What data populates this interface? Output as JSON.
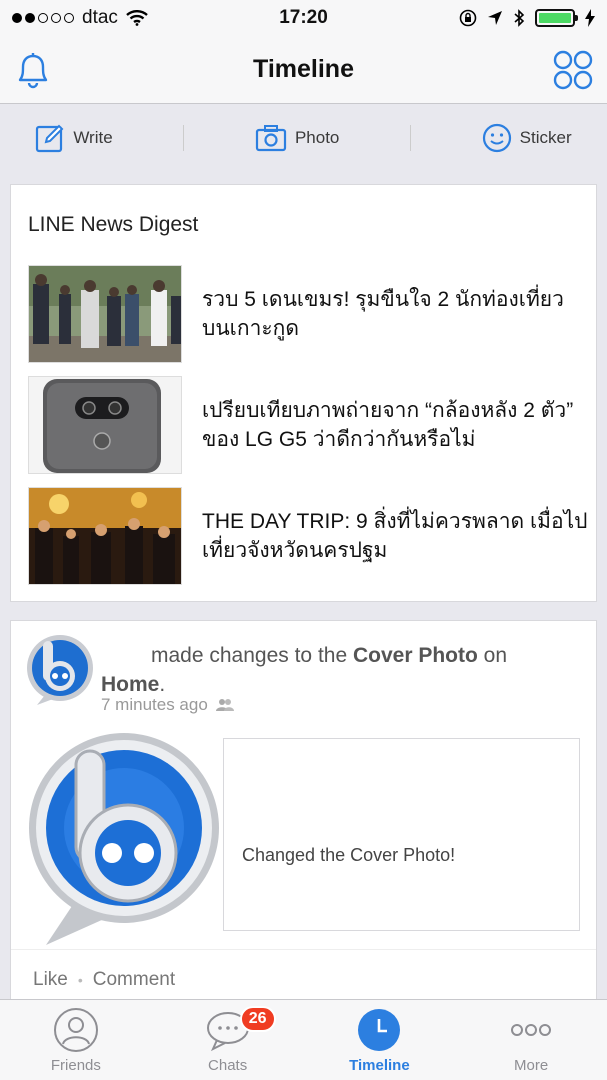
{
  "status_bar": {
    "carrier": "dtac",
    "time": "17:20"
  },
  "nav": {
    "title": "Timeline",
    "left_icon": "bell-icon",
    "right_icon": "grid-apps-icon"
  },
  "compose": {
    "write": "Write",
    "photo": "Photo",
    "sticker": "Sticker"
  },
  "news": {
    "title": "LINE News Digest",
    "items": [
      {
        "headline": "รวบ 5 เดนเขมร! รุมขืนใจ 2 นักท่องเที่ยวบนเกาะกูด"
      },
      {
        "headline": "เปรียบเทียบภาพถ่ายจาก “กล้องหลัง 2 ตัว” ของ LG G5 ว่าดีกว่ากันหรือไม่"
      },
      {
        "headline": "THE DAY TRIP: 9 สิ่งที่ไม่ควรพลาด เมื่อไปเที่ยวจังหวัดนครปฐม"
      }
    ]
  },
  "post": {
    "action_text": "made changes to the",
    "target": "Cover Photo",
    "on_text": "on",
    "place": "Home",
    "time": "7 minutes ago",
    "cover_caption": "Changed the Cover Photo!",
    "like": "Like",
    "comment": "Comment"
  },
  "tabs": [
    {
      "label": "Friends",
      "icon": "friends-icon"
    },
    {
      "label": "Chats",
      "icon": "chat-bubble-icon",
      "badge": "26"
    },
    {
      "label": "Timeline",
      "icon": "clock-icon",
      "active": true
    },
    {
      "label": "More",
      "icon": "more-dots-icon"
    }
  ],
  "colors": {
    "accent": "#2c7fe0",
    "badge": "#f03c22",
    "battery": "#4cd964"
  }
}
